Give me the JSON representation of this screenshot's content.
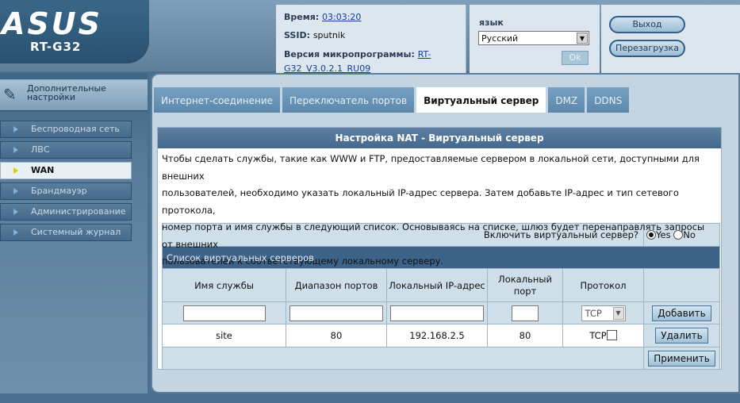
{
  "header": {
    "brand": "ASUS",
    "model": "RT-G32",
    "time_label": "Время:",
    "time_value": "03:03:20",
    "ssid_label": "SSID:",
    "ssid_value": "sputnik",
    "fw_label": "Версия микропрограммы:",
    "fw_value_line1": "RT-",
    "fw_value_line2": "G32_V3.0.2.1_RU09",
    "lang_label": "язык",
    "lang_value": "Русский",
    "ok_label": "Ok",
    "logout_label": "Выход",
    "reboot_label": "Перезагрузка"
  },
  "sidebar": {
    "header_line1": "Дополнительные",
    "header_line2": "настройки",
    "items": [
      {
        "label": "Беспроводная сеть"
      },
      {
        "label": "ЛВС"
      },
      {
        "label": "WAN"
      },
      {
        "label": "Брандмауэр"
      },
      {
        "label": "Администрирование"
      },
      {
        "label": "Системный журнал"
      }
    ],
    "active_item": "WAN"
  },
  "tabs": [
    {
      "label": "Интернет-соединение"
    },
    {
      "label": "Переключатель портов"
    },
    {
      "label": "Виртуальный сервер"
    },
    {
      "label": "DMZ"
    },
    {
      "label": "DDNS"
    }
  ],
  "active_tab": "Виртуальный сервер",
  "panel": {
    "title": "Настройка NAT - Виртуальный сервер",
    "description_lines": [
      "Чтобы сделать службы, такие как WWW и FTP, предоставляемые сервером в локальной сети, доступными для внешних",
      "пользователей, необходимо указать локальный IP-адрес сервера. Затем добавьте IP-адрес и тип сетевого протокола,",
      "номер порта и имя службы в следующий список. Основываясь на списке, шлюз будет перенаправлять запросы от внешних",
      "пользователей к соответствующему локальному серверу."
    ],
    "enable_label": "Включить виртуальный сервер?",
    "yes_label": "Yes",
    "no_label": "No",
    "enabled": "Yes",
    "list_title": "Список виртуальных серверов",
    "columns": [
      "Имя службы",
      "Диапазон портов",
      "Локальный IP-адрес",
      "Локальный порт",
      "Протокол"
    ],
    "protocol_default": "TCP",
    "add_label": "Добавить",
    "rows": [
      {
        "service": "site",
        "ports": "80",
        "ip": "192.168.2.5",
        "local_port": "80",
        "protocol": "TCP"
      }
    ],
    "delete_label": "Удалить",
    "apply_label": "Применить"
  }
}
